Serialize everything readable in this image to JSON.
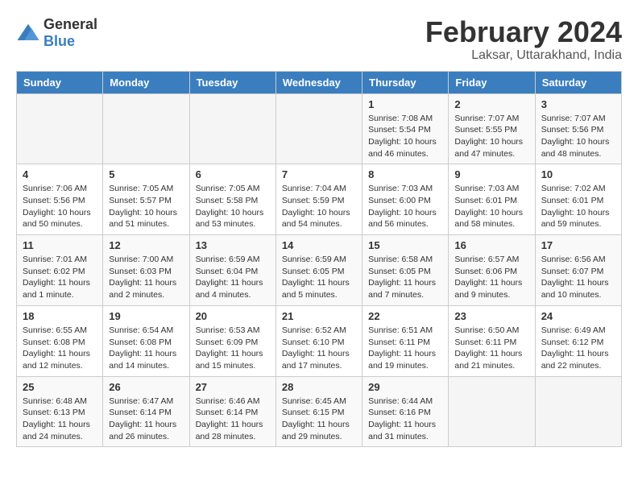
{
  "logo": {
    "text_general": "General",
    "text_blue": "Blue"
  },
  "header": {
    "month_year": "February 2024",
    "location": "Laksar, Uttarakhand, India"
  },
  "weekdays": [
    "Sunday",
    "Monday",
    "Tuesday",
    "Wednesday",
    "Thursday",
    "Friday",
    "Saturday"
  ],
  "weeks": [
    [
      {
        "day": "",
        "empty": true
      },
      {
        "day": "",
        "empty": true
      },
      {
        "day": "",
        "empty": true
      },
      {
        "day": "",
        "empty": true
      },
      {
        "day": "1",
        "sunrise": "7:08 AM",
        "sunset": "5:54 PM",
        "daylight": "10 hours and 46 minutes."
      },
      {
        "day": "2",
        "sunrise": "7:07 AM",
        "sunset": "5:55 PM",
        "daylight": "10 hours and 47 minutes."
      },
      {
        "day": "3",
        "sunrise": "7:07 AM",
        "sunset": "5:56 PM",
        "daylight": "10 hours and 48 minutes."
      }
    ],
    [
      {
        "day": "4",
        "sunrise": "7:06 AM",
        "sunset": "5:56 PM",
        "daylight": "10 hours and 50 minutes."
      },
      {
        "day": "5",
        "sunrise": "7:05 AM",
        "sunset": "5:57 PM",
        "daylight": "10 hours and 51 minutes."
      },
      {
        "day": "6",
        "sunrise": "7:05 AM",
        "sunset": "5:58 PM",
        "daylight": "10 hours and 53 minutes."
      },
      {
        "day": "7",
        "sunrise": "7:04 AM",
        "sunset": "5:59 PM",
        "daylight": "10 hours and 54 minutes."
      },
      {
        "day": "8",
        "sunrise": "7:03 AM",
        "sunset": "6:00 PM",
        "daylight": "10 hours and 56 minutes."
      },
      {
        "day": "9",
        "sunrise": "7:03 AM",
        "sunset": "6:01 PM",
        "daylight": "10 hours and 58 minutes."
      },
      {
        "day": "10",
        "sunrise": "7:02 AM",
        "sunset": "6:01 PM",
        "daylight": "10 hours and 59 minutes."
      }
    ],
    [
      {
        "day": "11",
        "sunrise": "7:01 AM",
        "sunset": "6:02 PM",
        "daylight": "11 hours and 1 minute."
      },
      {
        "day": "12",
        "sunrise": "7:00 AM",
        "sunset": "6:03 PM",
        "daylight": "11 hours and 2 minutes."
      },
      {
        "day": "13",
        "sunrise": "6:59 AM",
        "sunset": "6:04 PM",
        "daylight": "11 hours and 4 minutes."
      },
      {
        "day": "14",
        "sunrise": "6:59 AM",
        "sunset": "6:05 PM",
        "daylight": "11 hours and 5 minutes."
      },
      {
        "day": "15",
        "sunrise": "6:58 AM",
        "sunset": "6:05 PM",
        "daylight": "11 hours and 7 minutes."
      },
      {
        "day": "16",
        "sunrise": "6:57 AM",
        "sunset": "6:06 PM",
        "daylight": "11 hours and 9 minutes."
      },
      {
        "day": "17",
        "sunrise": "6:56 AM",
        "sunset": "6:07 PM",
        "daylight": "11 hours and 10 minutes."
      }
    ],
    [
      {
        "day": "18",
        "sunrise": "6:55 AM",
        "sunset": "6:08 PM",
        "daylight": "11 hours and 12 minutes."
      },
      {
        "day": "19",
        "sunrise": "6:54 AM",
        "sunset": "6:08 PM",
        "daylight": "11 hours and 14 minutes."
      },
      {
        "day": "20",
        "sunrise": "6:53 AM",
        "sunset": "6:09 PM",
        "daylight": "11 hours and 15 minutes."
      },
      {
        "day": "21",
        "sunrise": "6:52 AM",
        "sunset": "6:10 PM",
        "daylight": "11 hours and 17 minutes."
      },
      {
        "day": "22",
        "sunrise": "6:51 AM",
        "sunset": "6:11 PM",
        "daylight": "11 hours and 19 minutes."
      },
      {
        "day": "23",
        "sunrise": "6:50 AM",
        "sunset": "6:11 PM",
        "daylight": "11 hours and 21 minutes."
      },
      {
        "day": "24",
        "sunrise": "6:49 AM",
        "sunset": "6:12 PM",
        "daylight": "11 hours and 22 minutes."
      }
    ],
    [
      {
        "day": "25",
        "sunrise": "6:48 AM",
        "sunset": "6:13 PM",
        "daylight": "11 hours and 24 minutes."
      },
      {
        "day": "26",
        "sunrise": "6:47 AM",
        "sunset": "6:14 PM",
        "daylight": "11 hours and 26 minutes."
      },
      {
        "day": "27",
        "sunrise": "6:46 AM",
        "sunset": "6:14 PM",
        "daylight": "11 hours and 28 minutes."
      },
      {
        "day": "28",
        "sunrise": "6:45 AM",
        "sunset": "6:15 PM",
        "daylight": "11 hours and 29 minutes."
      },
      {
        "day": "29",
        "sunrise": "6:44 AM",
        "sunset": "6:16 PM",
        "daylight": "11 hours and 31 minutes."
      },
      {
        "day": "",
        "empty": true
      },
      {
        "day": "",
        "empty": true
      }
    ]
  ],
  "labels": {
    "sunrise": "Sunrise:",
    "sunset": "Sunset:",
    "daylight": "Daylight:"
  }
}
